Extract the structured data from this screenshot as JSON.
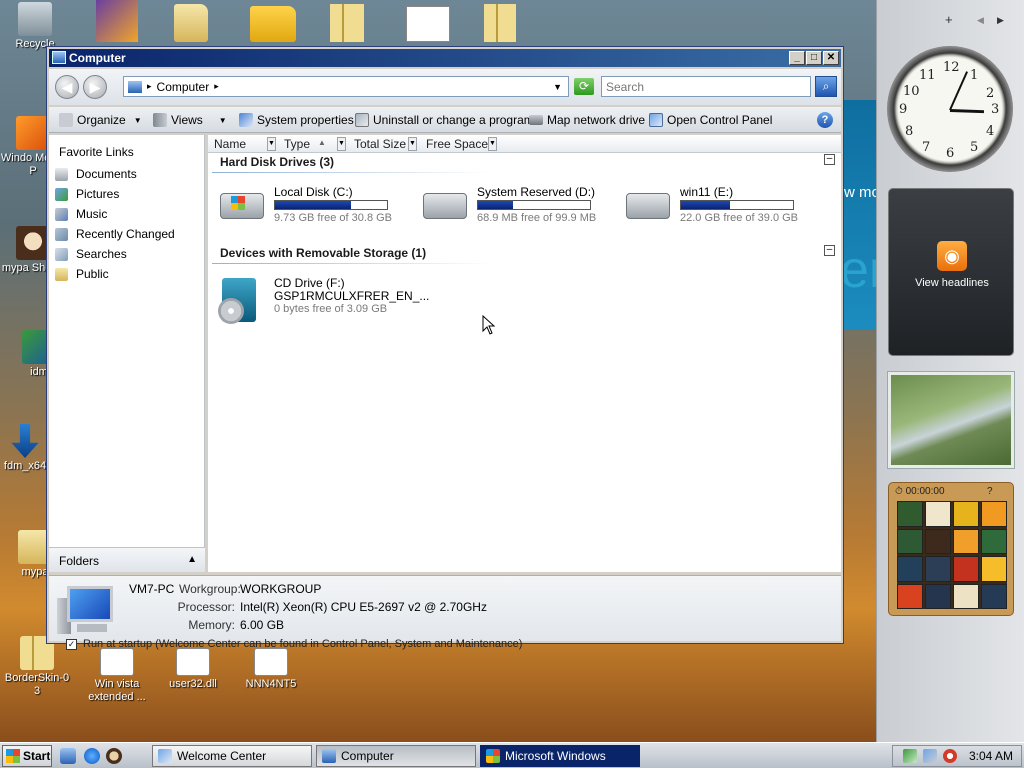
{
  "desktop": {
    "icons": [
      {
        "label": "Recycle",
        "name": "recycle-bin"
      },
      {
        "label": "Windo Media P",
        "name": "windows-media-player"
      },
      {
        "label": "mypa Shorto",
        "name": "mypaint-shortcut"
      },
      {
        "label": "idm",
        "name": "idm"
      },
      {
        "label": "fdm_x64",
        "name": "fdm-x64"
      },
      {
        "label": "mypa",
        "name": "mypaint"
      },
      {
        "label": "BorderSkin-0 3",
        "name": "borderskin-zip"
      },
      {
        "label": "Win vista extended ...",
        "name": "win-vista-extended"
      },
      {
        "label": "user32.dll",
        "name": "user32-dll"
      },
      {
        "label": "NNN4NT5",
        "name": "nnn4nt5"
      }
    ],
    "background_text": {
      "partial": "w mo",
      "large": "er"
    }
  },
  "sidebar": {
    "add_label": "+",
    "prev_label": "◀",
    "next_label": "▶",
    "clock_numbers": [
      "12",
      "1",
      "2",
      "3",
      "4",
      "5",
      "6",
      "7",
      "8",
      "9",
      "10",
      "11"
    ],
    "feed_label": "View headlines",
    "puzzle_timer": "00:00:00",
    "puzzle_help": "?"
  },
  "window": {
    "title": "Computer",
    "controls": {
      "minimize": "_",
      "maximize": "□",
      "close": "✕"
    },
    "address": {
      "path": "Computer",
      "separator": "▸"
    },
    "search_placeholder": "Search",
    "toolbar": {
      "organize": "Organize",
      "views": "Views",
      "system_properties": "System properties",
      "uninstall": "Uninstall or change a program",
      "map_drive": "Map network drive",
      "control_panel": "Open Control Panel",
      "help": "?"
    },
    "nav": {
      "heading": "Favorite Links",
      "links": [
        "Documents",
        "Pictures",
        "Music",
        "Recently Changed",
        "Searches",
        "Public"
      ],
      "folders_label": "Folders"
    },
    "columns": [
      "Name",
      "Type",
      "Total Size",
      "Free Space"
    ],
    "groups": {
      "hdd": "Hard Disk Drives (3)",
      "removable": "Devices with Removable Storage (1)"
    },
    "drives": [
      {
        "name": "Local Disk (C:)",
        "free": "9.73 GB free of 30.8 GB",
        "used_fraction": 0.68
      },
      {
        "name": "System Reserved (D:)",
        "free": "68.9 MB free of 99.9 MB",
        "used_fraction": 0.31
      },
      {
        "name": "win11 (E:)",
        "free": "22.0 GB free of 39.0 GB",
        "used_fraction": 0.44
      }
    ],
    "cd": {
      "name": "CD Drive (F:)",
      "label": "GSP1RMCULXFRER_EN_...",
      "free": "0 bytes free of 3.09 GB"
    },
    "details": {
      "pc_name": "VM7-PC",
      "workgroup_label": "Workgroup:",
      "workgroup": "WORKGROUP",
      "processor_label": "Processor:",
      "processor": "Intel(R) Xeon(R) CPU E5-2697 v2 @ 2.70GHz",
      "memory_label": "Memory:",
      "memory": "6.00 GB"
    }
  },
  "welcome_strip": "Run at startup (Welcome Center can be found in Control Panel, System and Maintenance)",
  "taskbar": {
    "start": "Start",
    "tasks": [
      "Welcome Center",
      "Computer",
      "Microsoft Windows"
    ],
    "clock": "3:04 AM"
  }
}
